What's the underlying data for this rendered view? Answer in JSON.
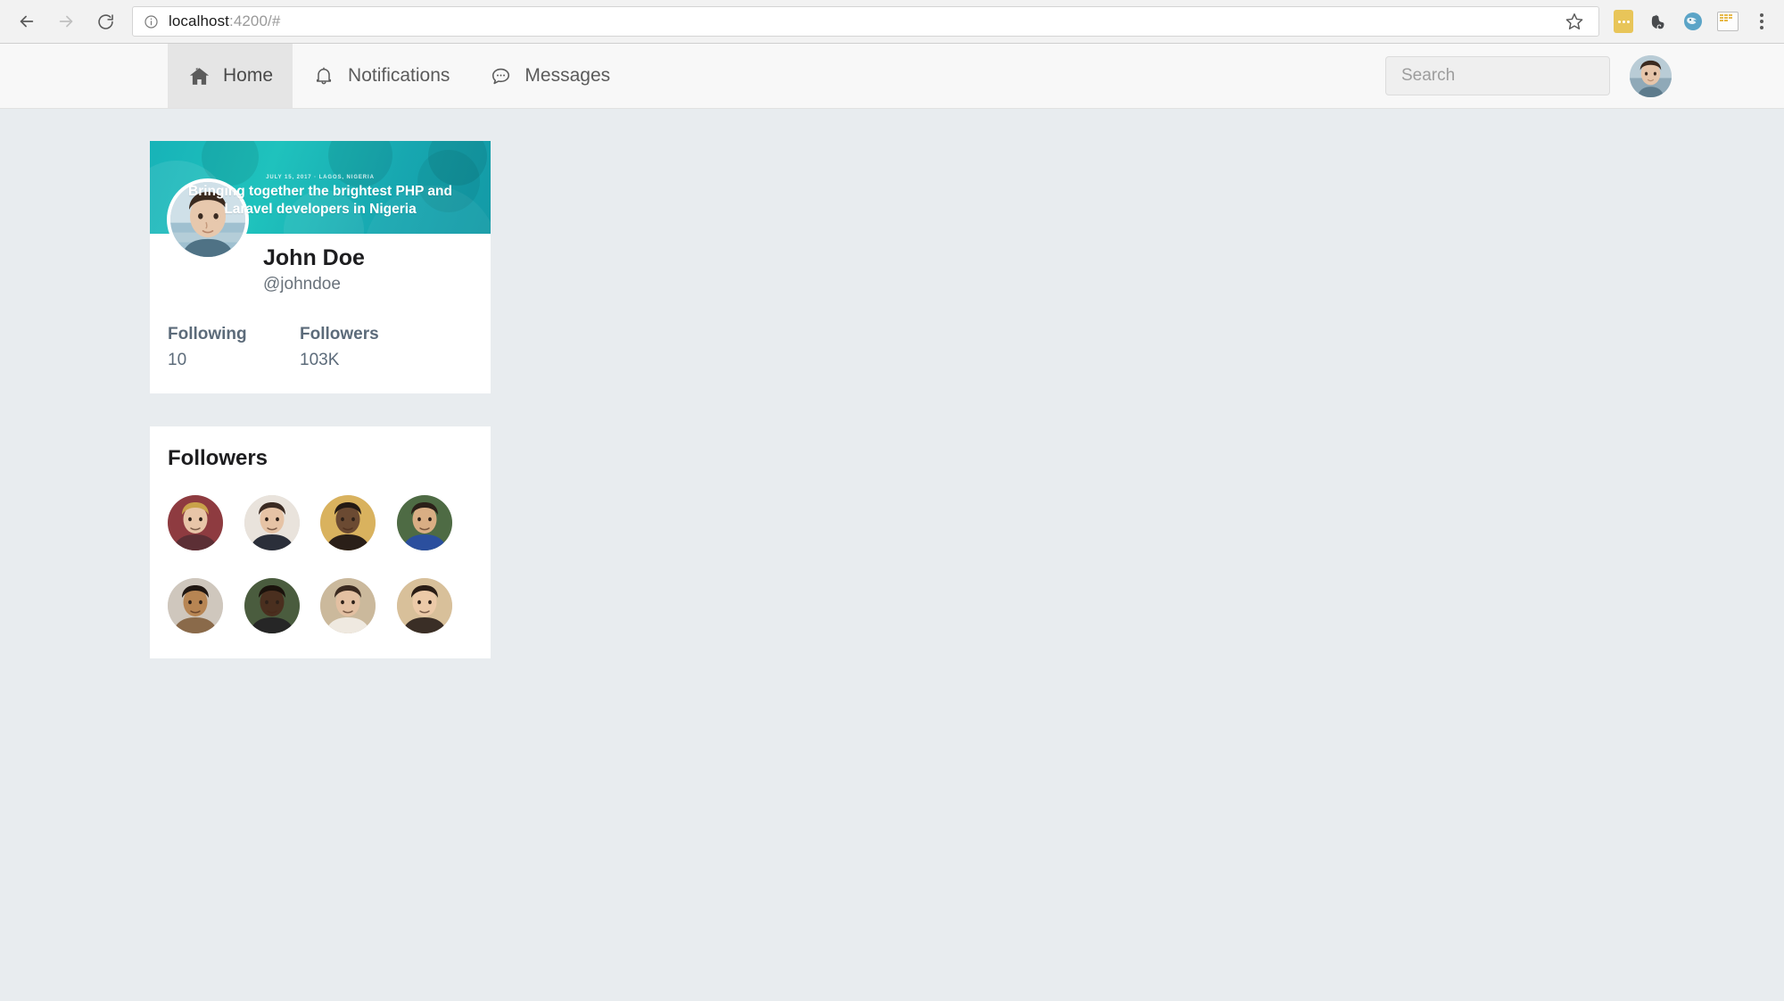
{
  "browser": {
    "url_host": "localhost",
    "url_path": ":4200/#",
    "back_icon": "back-arrow-icon",
    "forward_icon": "forward-arrow-icon",
    "reload_icon": "reload-icon",
    "info_icon": "page-info-icon",
    "bookmark_icon": "star-icon",
    "extensions": [
      {
        "name": "yellow-notes-extension-icon"
      },
      {
        "name": "evernote-extension-icon"
      },
      {
        "name": "teal-bird-extension-icon"
      },
      {
        "name": "calendar-extension-icon"
      }
    ],
    "menu_icon": "three-dot-menu-icon"
  },
  "navbar": {
    "items": [
      {
        "label": "Home",
        "icon": "home-icon",
        "active": true
      },
      {
        "label": "Notifications",
        "icon": "bell-icon",
        "active": false
      },
      {
        "label": "Messages",
        "icon": "chat-bubble-icon",
        "active": false
      }
    ],
    "search": {
      "placeholder": "Search",
      "value": ""
    },
    "avatar_name": "navbar-user-avatar"
  },
  "profile": {
    "banner": {
      "eyebrow": "JULY 15, 2017 · LAGOS, NIGERIA",
      "headline": "Bringing together the brightest PHP and Laravel developers in Nigeria"
    },
    "avatar_name": "profile-avatar",
    "name": "John Doe",
    "handle": "@johndoe",
    "stats": [
      {
        "label": "Following",
        "value": "10"
      },
      {
        "label": "Followers",
        "value": "103K"
      }
    ]
  },
  "followers_panel": {
    "title": "Followers",
    "avatars": [
      {
        "name": "follower-avatar-1",
        "skin": "#e8c5a8",
        "hair": "#c9a24a",
        "bg": "#8e3b40",
        "shirt": "#5c2f35"
      },
      {
        "name": "follower-avatar-2",
        "skin": "#e6c3a5",
        "hair": "#3a2a22",
        "bg": "#e9e3dc",
        "shirt": "#2b2f3a"
      },
      {
        "name": "follower-avatar-3",
        "skin": "#6b4a32",
        "hair": "#241a14",
        "bg": "#d9b25e",
        "shirt": "#2a1f18"
      },
      {
        "name": "follower-avatar-4",
        "skin": "#d9ae84",
        "hair": "#2b2019",
        "bg": "#4e6b44",
        "shirt": "#2b4f9e"
      },
      {
        "name": "follower-avatar-5",
        "skin": "#b78553",
        "hair": "#201712",
        "bg": "#cfc7bd",
        "shirt": "#8a6a4a"
      },
      {
        "name": "follower-avatar-6",
        "skin": "#4a2f1f",
        "hair": "#1a120c",
        "bg": "#4a5c3e",
        "shirt": "#262626"
      },
      {
        "name": "follower-avatar-7",
        "skin": "#e3c0a2",
        "hair": "#3b2a20",
        "bg": "#cbb99c",
        "shirt": "#efe9e0"
      },
      {
        "name": "follower-avatar-8",
        "skin": "#eccaa8",
        "hair": "#2a1d15",
        "bg": "#d8c09a",
        "shirt": "#3a2e26"
      }
    ]
  },
  "colors": {
    "page_background": "#e8ecef",
    "card_background": "#ffffff",
    "banner_accent": "#17b3b8",
    "navbar_background": "#f8f8f8",
    "active_tab_background": "#e5e5e5"
  }
}
